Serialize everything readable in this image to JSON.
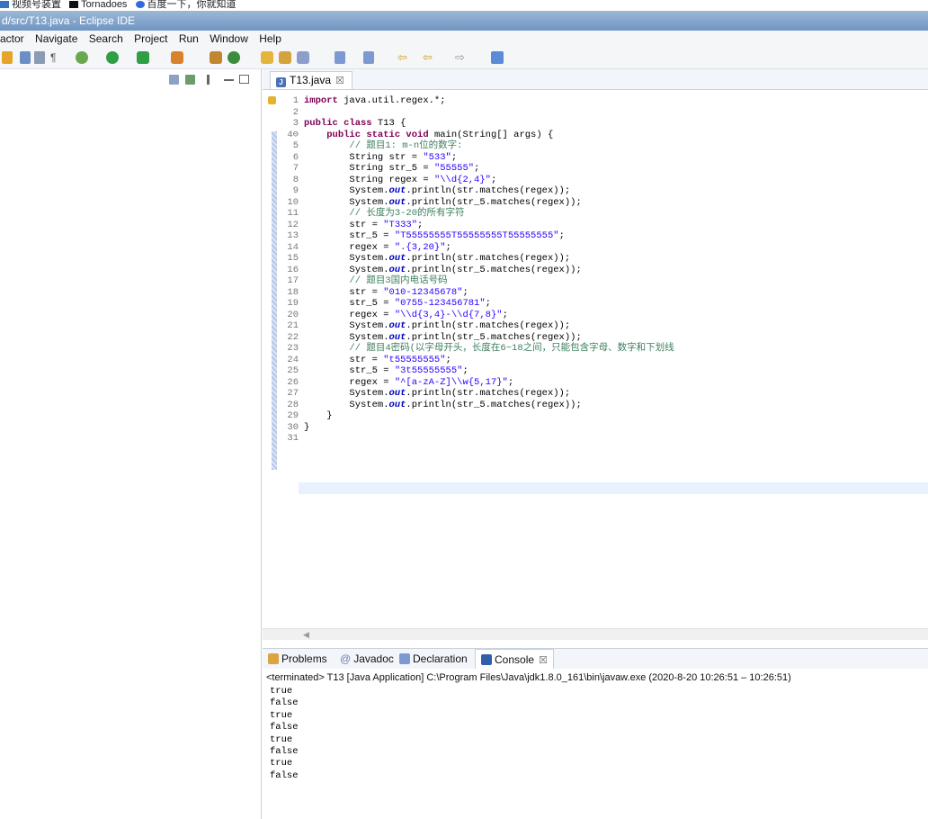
{
  "bookmarks": [
    "视频号装置",
    "Tornadoes",
    "百度一下，你就知道"
  ],
  "window": {
    "title": "d/src/T13.java - Eclipse IDE"
  },
  "menu": [
    "actor",
    "Navigate",
    "Search",
    "Project",
    "Run",
    "Window",
    "Help"
  ],
  "editor": {
    "tab_label": "T13.java",
    "tab_close": "☒",
    "lines": [
      {
        "n": "1",
        "html": "<span class='kw'>import</span> java.util.regex.*;"
      },
      {
        "n": "2",
        "html": ""
      },
      {
        "n": "3",
        "html": "<span class='kw'>public class</span> T13 {"
      },
      {
        "n": "4⊖",
        "html": "    <span class='kw'>public static void</span> main(String[] args) {"
      },
      {
        "n": "5",
        "html": "        <span class='com'>// 题目1: m-n位的数字:</span>"
      },
      {
        "n": "6",
        "html": "        String str = <span class='str'>\"533\"</span>;"
      },
      {
        "n": "7",
        "html": "        String str_5 = <span class='str'>\"55555\"</span>;"
      },
      {
        "n": "8",
        "html": "        String regex = <span class='str'>\"\\\\d{2,4}\"</span>;"
      },
      {
        "n": "9",
        "html": "        System.<span class='fld'>out</span>.println(str.matches(regex));"
      },
      {
        "n": "10",
        "html": "        System.<span class='fld'>out</span>.println(str_5.matches(regex));"
      },
      {
        "n": "11",
        "html": "        <span class='com'>// 长度为3-20的所有字符</span>"
      },
      {
        "n": "12",
        "html": "        str = <span class='str'>\"T333\"</span>;"
      },
      {
        "n": "13",
        "html": "        str_5 = <span class='str'>\"T55555555T55555555T55555555\"</span>;"
      },
      {
        "n": "14",
        "html": "        regex = <span class='str'>\".{3,20}\"</span>;"
      },
      {
        "n": "15",
        "html": "        System.<span class='fld'>out</span>.println(str.matches(regex));"
      },
      {
        "n": "16",
        "html": "        System.<span class='fld'>out</span>.println(str_5.matches(regex));"
      },
      {
        "n": "17",
        "html": "        <span class='com'>// 题目3国内电话号码</span>"
      },
      {
        "n": "18",
        "html": "        str = <span class='str'>\"010-12345678\"</span>;"
      },
      {
        "n": "19",
        "html": "        str_5 = <span class='str'>\"0755-123456781\"</span>;"
      },
      {
        "n": "20",
        "html": "        regex = <span class='str'>\"\\\\d{3,4}-\\\\d{7,8}\"</span>;"
      },
      {
        "n": "21",
        "html": "        System.<span class='fld'>out</span>.println(str.matches(regex));"
      },
      {
        "n": "22",
        "html": "        System.<span class='fld'>out</span>.println(str_5.matches(regex));"
      },
      {
        "n": "23",
        "html": "        <span class='com'>// 题目4密码(以字母开头，长度在6~18之间，只能包含字母、数字和下划线</span>"
      },
      {
        "n": "24",
        "html": "        str = <span class='str'>\"t55555555\"</span>;"
      },
      {
        "n": "25",
        "html": "        str_5 = <span class='str'>\"3t55555555\"</span>;"
      },
      {
        "n": "26",
        "html": "        regex = <span class='str'>\"^[a-zA-Z]\\\\w{5,17}\"</span>;"
      },
      {
        "n": "27",
        "html": "        System.<span class='fld'>out</span>.println(str.matches(regex));"
      },
      {
        "n": "28",
        "html": "        System.<span class='fld'>out</span>.println(str_5.matches(regex));"
      },
      {
        "n": "29",
        "html": "    }"
      },
      {
        "n": "30",
        "html": "}"
      },
      {
        "n": "31",
        "html": ""
      }
    ]
  },
  "bottom_tabs": {
    "problems": "Problems",
    "javadoc": "Javadoc",
    "declaration": "Declaration",
    "console": "Console",
    "console_close": "☒"
  },
  "console": {
    "header": "<terminated> T13 [Java Application] C:\\Program Files\\Java\\jdk1.8.0_161\\bin\\javaw.exe  (2020-8-20 10:26:51 – 10:26:51)",
    "output": [
      "true",
      "false",
      "true",
      "false",
      "true",
      "false",
      "true",
      "false"
    ]
  },
  "colors": {
    "keyword": "#7f0055",
    "string": "#2a00ff",
    "comment": "#3f7f5f",
    "field": "#0000c0"
  }
}
